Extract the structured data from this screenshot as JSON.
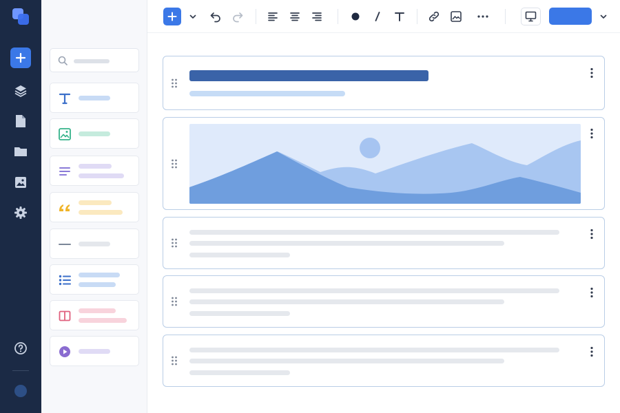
{
  "icons": {
    "app_logo": "app-logo-icon",
    "rail": [
      "plus-icon",
      "layers-icon",
      "document-icon",
      "folder-icon",
      "image-icon",
      "gear-icon",
      "help-icon"
    ],
    "palette": [
      "text-block-icon",
      "image-block-icon",
      "paragraph-block-icon",
      "quote-block-icon",
      "divider-block-icon",
      "list-block-icon",
      "columns-block-icon",
      "video-block-icon"
    ],
    "toolbar": [
      "plus-icon",
      "chevron-down-icon",
      "undo-icon",
      "redo-icon",
      "align-left-icon",
      "align-center-icon",
      "align-right-icon",
      "color-dot-icon",
      "italic-icon",
      "text-format-icon",
      "link-icon",
      "insert-image-icon",
      "more-horizontal-icon",
      "desktop-preview-icon",
      "chevron-down-icon"
    ],
    "card": [
      "drag-handle-icon",
      "kebab-menu-icon"
    ]
  },
  "colors": {
    "rail_bg": "#1b2a45",
    "accent": "#3b78e7",
    "card_border": "#b9cde6",
    "title_bar": "#3a63a8",
    "text_block": "#3b6fc9",
    "image_block": "#35b38a",
    "paragraph_block": "#8a7ad8",
    "quote_block": "#f0b429",
    "divider_block": "#7b8798",
    "list_block": "#3b6fc9",
    "columns_block": "#e0607e",
    "video_block": "#8a6cd0"
  },
  "canvas": {
    "blocks": [
      "heading",
      "image",
      "text",
      "text",
      "text"
    ]
  }
}
